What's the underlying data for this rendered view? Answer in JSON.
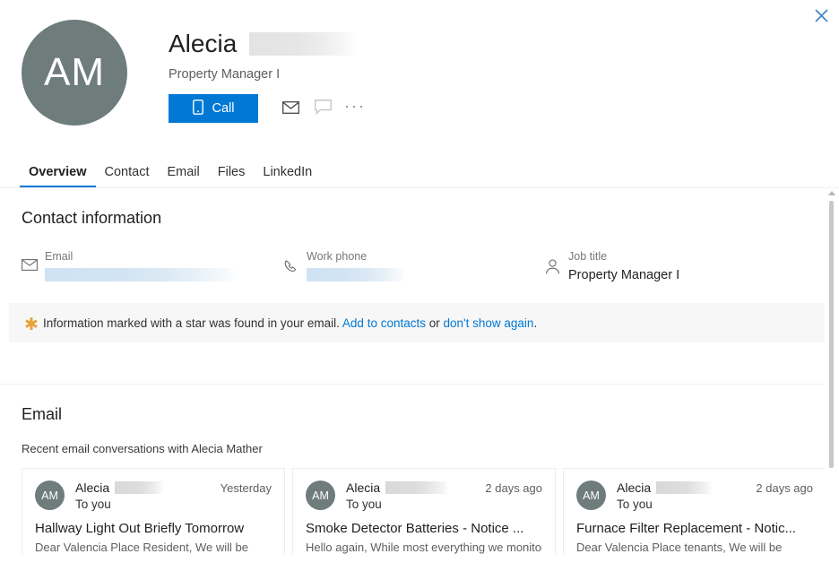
{
  "colors": {
    "accent": "#0078d4",
    "avatar_bg": "#6f7c7c",
    "star": "#e8a33d",
    "link": "#0078d4",
    "text_primary": "#201f1e",
    "text_secondary": "#605e5c",
    "banner_bg": "#f7f7f7"
  },
  "window": {
    "close_label": "Close",
    "close_icon": "close-icon"
  },
  "persona": {
    "initials": "AM",
    "first_name": "Alecia",
    "name_redacted": true,
    "job_title": "Property Manager I",
    "actions": {
      "call_label": "Call",
      "call_icon": "mobile-phone-icon",
      "mail_icon": "envelope-icon",
      "chat_icon": "chat-bubble-icon",
      "more_icon": "ellipsis-icon",
      "more_label": "···"
    }
  },
  "tabs": [
    {
      "label": "Overview",
      "active": true
    },
    {
      "label": "Contact",
      "active": false
    },
    {
      "label": "Email",
      "active": false
    },
    {
      "label": "Files",
      "active": false
    },
    {
      "label": "LinkedIn",
      "active": false
    }
  ],
  "contact_section": {
    "title": "Contact information",
    "fields": [
      {
        "label": "Email",
        "value": "",
        "redacted": true,
        "icon": "envelope-icon"
      },
      {
        "label": "Work phone",
        "value": "",
        "redacted": true,
        "icon": "phone-icon"
      },
      {
        "label": "Job title",
        "value": "Property Manager I",
        "redacted": false,
        "icon": "person-icon"
      }
    ],
    "banner": {
      "star_glyph": "✱",
      "text_before": "Information marked with a star was found in your email.",
      "link_add": "Add to contacts",
      "text_or": "or",
      "link_dismiss": "don't show again",
      "text_end": "."
    }
  },
  "email_section": {
    "title": "Email",
    "subtitle": "Recent email conversations with Alecia Mather",
    "cards": [
      {
        "initials": "AM",
        "from": "Alecia",
        "from_redacted": true,
        "date": "Yesterday",
        "to": "To you",
        "subject": "Hallway Light Out Briefly Tomorrow",
        "preview": "Dear Valencia Place Resident, We will be"
      },
      {
        "initials": "AM",
        "from": "Alecia",
        "from_redacted": true,
        "date": "2 days ago",
        "to": "To you",
        "subject": "Smoke Detector Batteries - Notice ...",
        "preview": "Hello again, While most everything we monitor"
      },
      {
        "initials": "AM",
        "from": "Alecia",
        "from_redacted": true,
        "date": "2 days ago",
        "to": "To you",
        "subject": "Furnace Filter Replacement - Notic...",
        "preview": "Dear Valencia Place tenants, We will be"
      }
    ]
  },
  "scrollbar": {
    "up_arrow_icon": "chevron-up-icon",
    "visible": true
  }
}
